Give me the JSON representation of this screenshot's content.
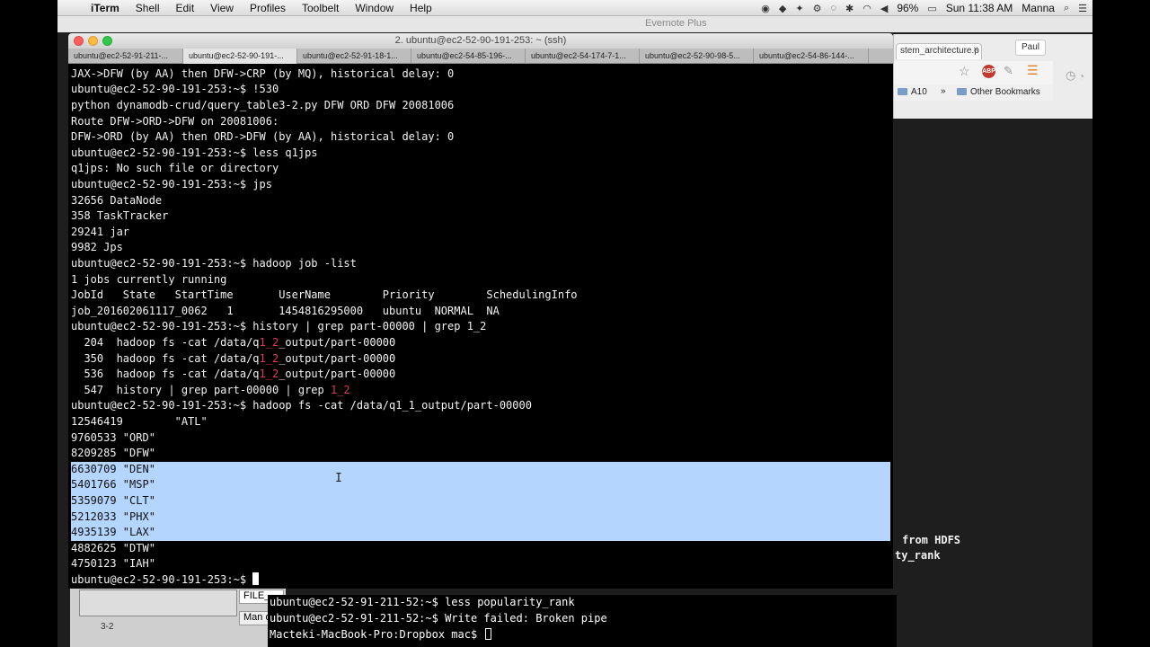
{
  "menubar": {
    "items": [
      "iTerm",
      "Shell",
      "Edit",
      "View",
      "Profiles",
      "Toolbelt",
      "Window",
      "Help"
    ],
    "battery": "96%",
    "clock": "Sun 11:38 AM",
    "user": "Manna"
  },
  "evernote": {
    "title": "Evernote Plus"
  },
  "browser": {
    "tab_label": "stem_architecture.p",
    "profile": "Paul",
    "bookmark1": "A10",
    "bookmark2": "Other Bookmarks"
  },
  "iterm": {
    "title": "2. ubuntu@ec2-52-90-191-253: ~ (ssh)",
    "tabs": [
      "ubuntu@ec2-52-91-211-...",
      "ubuntu@ec2-52-90-191-...",
      "ubuntu@ec2-52-91-18-1...",
      "ubuntu@ec2-54-85-196-...",
      "ubuntu@ec2-54-174-7-1...",
      "ubuntu@ec2-52-90-98-5...",
      "ubuntu@ec2-54-86-144-..."
    ],
    "lines": {
      "l0": "JAX->DFW (by AA) then DFW->CRP (by MQ), historical delay: 0",
      "l1": "ubuntu@ec2-52-90-191-253:~$ !530",
      "l2": "python dynamodb-crud/query_table3-2.py DFW ORD DFW 20081006",
      "l3": "Route DFW->ORD->DFW on 20081006:",
      "l4": "DFW->ORD (by AA) then ORD->DFW (by AA), historical delay: 0",
      "l5": "ubuntu@ec2-52-90-191-253:~$ less q1jps",
      "l6": "q1jps: No such file or directory",
      "l7": "ubuntu@ec2-52-90-191-253:~$ jps",
      "l8": "32656 DataNode",
      "l9": "358 TaskTracker",
      "l10": "29241 jar",
      "l11": "9982 Jps",
      "l12": "ubuntu@ec2-52-90-191-253:~$ hadoop job -list",
      "l13": "1 jobs currently running",
      "l14": "JobId   State   StartTime       UserName        Priority        SchedulingInfo",
      "l15": "job_201602061117_0062   1       1454816295000   ubuntu  NORMAL  NA",
      "l16": "ubuntu@ec2-52-90-191-253:~$ history | grep part-00000 | grep 1_2",
      "l17a": "  204  hadoop fs -cat /data/q",
      "l17b": "1_2",
      "l17c": "_output/part-00000",
      "l18a": "  350  hadoop fs -cat /data/q",
      "l18b": "1_2",
      "l18c": "_output/part-00000",
      "l19a": "  536  hadoop fs -cat /data/q",
      "l19b": "1_2",
      "l19c": "_output/part-00000",
      "l20a": "  547  history | grep part-00000 | grep ",
      "l20b": "1_2",
      "l21": "ubuntu@ec2-52-90-191-253:~$ hadoop fs -cat /data/q1_1_output/part-00000",
      "l22": "12546419        \"ATL\"",
      "l23": "9760533 \"ORD\"",
      "l24": "8209285 \"DFW\"",
      "l25": "6630709 \"DEN\"",
      "l26": "5401766 \"MSP\"",
      "l27": "5359079 \"CLT\"",
      "l28": "5212033 \"PHX\"",
      "l29": "4935139 \"LAX\"",
      "l30": "4882625 \"DTW\"",
      "l31": "4750123 \"IAH\"",
      "l32": "ubuntu@ec2-52-90-191-253:~$ "
    }
  },
  "peek": {
    "line1": "from HDFS",
    "line2": "ty_rank"
  },
  "oldwin": {
    "cell1": "FILE_",
    "cell2": "Man o",
    "label": "3-2"
  },
  "localterm": {
    "line1": "ubuntu@ec2-52-91-211-52:~$ less popularity_rank",
    "line2": "ubuntu@ec2-52-91-211-52:~$ Write failed: Broken pipe",
    "line3": "Macteki-MacBook-Pro:Dropbox mac$ "
  }
}
